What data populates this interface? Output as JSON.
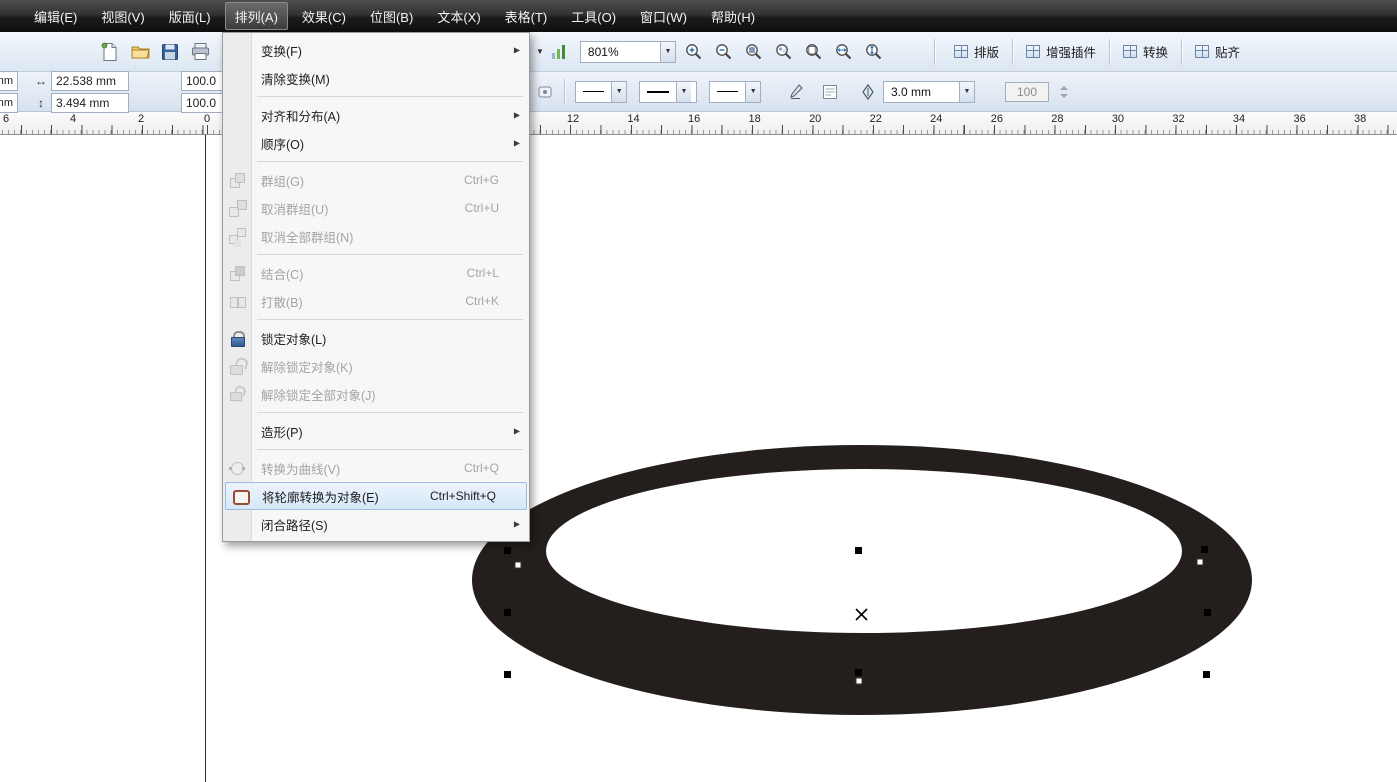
{
  "colors": {
    "ring_fill": "#241f1d",
    "menubar_bg": "#2b2b2b",
    "toolbar_bg": "#e3ecf5",
    "menu_highlight_border": "#9ebcdf"
  },
  "menubar": {
    "items": [
      {
        "key": "edit",
        "label": "编辑(E)"
      },
      {
        "key": "view",
        "label": "视图(V)"
      },
      {
        "key": "layout",
        "label": "版面(L)"
      },
      {
        "key": "arrange",
        "label": "排列(A)",
        "active": true
      },
      {
        "key": "effects",
        "label": "效果(C)"
      },
      {
        "key": "bitmaps",
        "label": "位图(B)"
      },
      {
        "key": "text",
        "label": "文本(X)"
      },
      {
        "key": "table",
        "label": "表格(T)"
      },
      {
        "key": "tools",
        "label": "工具(O)"
      },
      {
        "key": "window",
        "label": "窗口(W)"
      },
      {
        "key": "help",
        "label": "帮助(H)"
      }
    ]
  },
  "standard_toolbar": {
    "zoom_value": "801%",
    "group_buttons": [
      {
        "key": "typesetting",
        "label": "排版"
      },
      {
        "key": "plugins",
        "label": "增强插件"
      },
      {
        "key": "convert",
        "label": "转换"
      },
      {
        "key": "snap",
        "label": "贴齐"
      }
    ]
  },
  "property_bar": {
    "pos_x_unit": "mm",
    "pos_y_unit": "mm",
    "object_width": "22.538 mm",
    "object_height": "3.494 mm",
    "scale_h": "100.0",
    "scale_v": "100.0",
    "outline_width": "3.0 mm",
    "transparency": "100"
  },
  "ruler": {
    "numbers_left": [
      "6",
      "4",
      "2",
      "0"
    ],
    "numbers_right": [
      "12",
      "14",
      "16",
      "18",
      "20",
      "22",
      "24",
      "26",
      "28",
      "30",
      "32",
      "34",
      "36",
      "38"
    ]
  },
  "arrange_menu": {
    "items": [
      {
        "label": "变换(F)",
        "submenu": true
      },
      {
        "label": "清除变换(M)"
      },
      {
        "type": "sep"
      },
      {
        "label": "对齐和分布(A)",
        "submenu": true
      },
      {
        "label": "顺序(O)",
        "submenu": true
      },
      {
        "type": "sep"
      },
      {
        "label": "群组(G)",
        "shortcut": "Ctrl+G",
        "disabled": true,
        "icon": "group-icon"
      },
      {
        "label": "取消群组(U)",
        "shortcut": "Ctrl+U",
        "disabled": true,
        "icon": "ungroup-icon"
      },
      {
        "label": "取消全部群组(N)",
        "disabled": true,
        "icon": "ungroup-all-icon"
      },
      {
        "type": "sep"
      },
      {
        "label": "结合(C)",
        "shortcut": "Ctrl+L",
        "disabled": true,
        "icon": "combine-icon"
      },
      {
        "label": "打散(B)",
        "shortcut": "Ctrl+K",
        "disabled": true,
        "icon": "break-apart-icon"
      },
      {
        "type": "sep"
      },
      {
        "label": "锁定对象(L)",
        "icon": "lock-icon"
      },
      {
        "label": "解除锁定对象(K)",
        "disabled": true,
        "icon": "unlock-icon"
      },
      {
        "label": "解除锁定全部对象(J)",
        "disabled": true,
        "icon": "unlock-all-icon"
      },
      {
        "type": "sep"
      },
      {
        "label": "造形(P)",
        "submenu": true
      },
      {
        "type": "sep"
      },
      {
        "label": "转换为曲线(V)",
        "shortcut": "Ctrl+Q",
        "disabled": true,
        "icon": "convert-to-curves-icon"
      },
      {
        "label": "将轮廓转换为对象(E)",
        "shortcut": "Ctrl+Shift+Q",
        "highlighted": true,
        "icon": "outline-to-object-icon"
      },
      {
        "label": "闭合路径(S)",
        "submenu": true
      }
    ]
  }
}
